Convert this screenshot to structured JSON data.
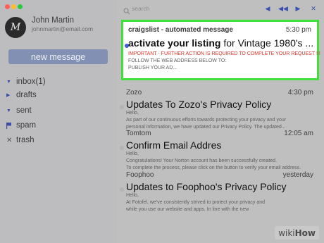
{
  "window": {
    "traffic_lights": [
      "#ff5f56",
      "#ffbd2e",
      "#27c93f"
    ]
  },
  "user": {
    "avatar_letter": "M",
    "name": "John Martin",
    "email": "johnmartin@email.com"
  },
  "sidebar": {
    "new_message_label": "new message",
    "items": [
      {
        "label": "inbox(1)",
        "icon": "triangle-down-icon"
      },
      {
        "label": "drafts",
        "icon": "triangle-right-icon"
      },
      {
        "label": "sent",
        "icon": "triangle-down-icon"
      },
      {
        "label": "spam",
        "icon": "flag-icon"
      },
      {
        "label": "trash",
        "icon": "x-icon"
      }
    ]
  },
  "toolbar": {
    "search_placeholder": "search",
    "buttons": [
      "prev-icon",
      "double-prev-icon",
      "next-icon",
      "close-icon"
    ]
  },
  "emails": [
    {
      "sender": "craigslist - automated message",
      "time": "5:30 pm",
      "subject_bold": "activate your listing",
      "subject_rest": " for Vintage 1980's ...",
      "warning": "IMPORTANT - FURTHER ACTION IS REQUIRED TO COMPLETE YOUR REQUEST !!!",
      "lines": [
        "FOLLOW THE WEB ADDRESS BELOW TO:",
        "PUBLISH YOUR AD..."
      ],
      "unread": true
    },
    {
      "sender": "Zozo",
      "time": "4:30 pm",
      "subject": "Updates To Zozo's Privacy Policy",
      "lines": [
        "Hello,",
        "As part of our continuous efforts towards protecting your privacy and your",
        "personal information, we have updated our Privacy Policy. The updated..."
      ],
      "unread": false
    },
    {
      "sender": "Tomtom",
      "time": "12:05 am",
      "subject": "Confirm Email Addres",
      "lines": [
        "Hello,",
        "Congratulations! Your Norton account has been successfully created.",
        "To complete the process, please click on the button to verify your email address."
      ],
      "unread": false
    },
    {
      "sender": "Foophoo",
      "time": "yesterday",
      "subject": "Updates to Foophoo's Privacy Policy",
      "lines": [
        "Hello,",
        "At Fotofel, we've consistently strived to protect your privacy and",
        "while you use our website and apps. In line with the new"
      ],
      "unread": false
    }
  ],
  "watermark": {
    "prefix": "wiki",
    "suffix": "How"
  }
}
